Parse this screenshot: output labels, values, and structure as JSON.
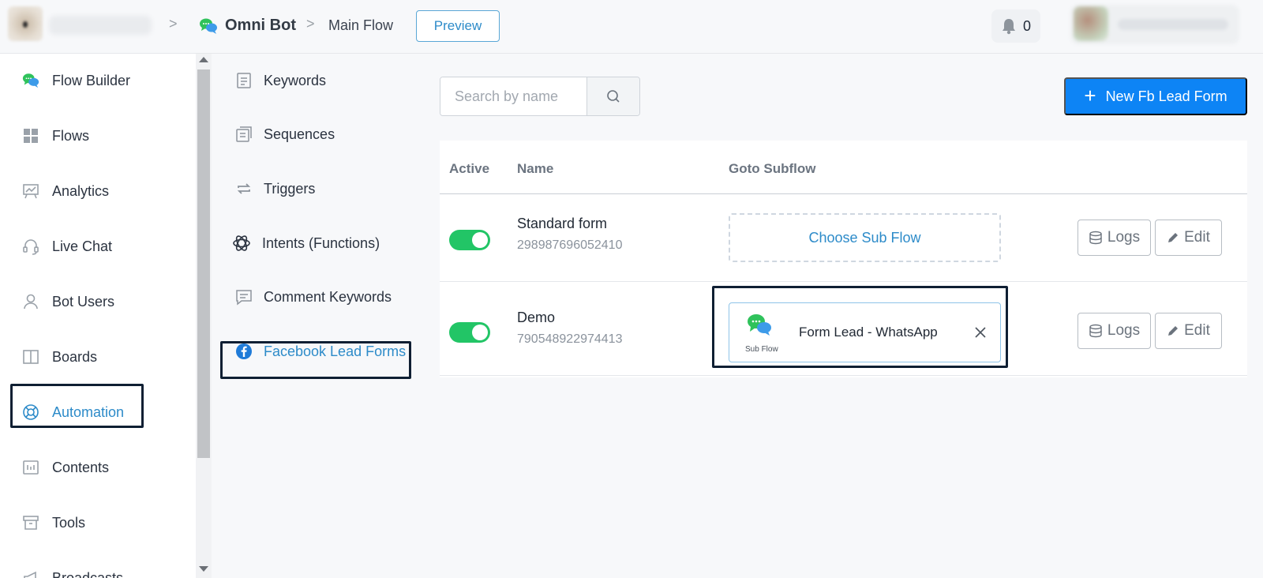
{
  "header": {
    "bot_name": "Omni Bot",
    "flow_name": "Main Flow",
    "preview_label": "Preview",
    "notification_count": "0",
    "separator": ">"
  },
  "sidebar": {
    "items": [
      {
        "label": "Flow Builder",
        "icon": "chat-bubbles-icon"
      },
      {
        "label": "Flows",
        "icon": "grid-icon"
      },
      {
        "label": "Analytics",
        "icon": "analytics-board-icon"
      },
      {
        "label": "Live Chat",
        "icon": "headset-icon"
      },
      {
        "label": "Bot Users",
        "icon": "user-icon"
      },
      {
        "label": "Boards",
        "icon": "board-columns-icon"
      },
      {
        "label": "Automation",
        "icon": "lifebuoy-icon",
        "active": true
      },
      {
        "label": "Contents",
        "icon": "contents-icon"
      },
      {
        "label": "Tools",
        "icon": "archive-box-icon"
      },
      {
        "label": "Broadcasts",
        "icon": "megaphone-icon"
      }
    ]
  },
  "subnav": {
    "items": [
      {
        "label": "Keywords",
        "icon": "document-icon"
      },
      {
        "label": "Sequences",
        "icon": "sequence-icon"
      },
      {
        "label": "Triggers",
        "icon": "repeat-icon"
      },
      {
        "label": "Intents (Functions)",
        "icon": "openai-icon"
      },
      {
        "label": "Comment Keywords",
        "icon": "comment-icon"
      },
      {
        "label": "Facebook Lead Forms",
        "icon": "facebook-icon",
        "active": true
      }
    ]
  },
  "main": {
    "search_placeholder": "Search by name",
    "new_button_label": "New Fb Lead Form",
    "table": {
      "headers": [
        "Active",
        "Name",
        "Goto Subflow"
      ],
      "rows": [
        {
          "active": true,
          "name": "Standard form",
          "id": "298987696052410",
          "subflow": null,
          "choose_label": "Choose Sub Flow",
          "logs_label": "Logs",
          "edit_label": "Edit"
        },
        {
          "active": true,
          "name": "Demo",
          "id": "790548922974413",
          "subflow": {
            "title": "Form Lead - WhatsApp",
            "tag": "Sub Flow"
          },
          "logs_label": "Logs",
          "edit_label": "Edit"
        }
      ]
    }
  },
  "colors": {
    "accent": "#2d8bc9",
    "primary_button": "#0d84f5",
    "toggle_on": "#22c566",
    "highlight_box": "#0f1f33"
  }
}
